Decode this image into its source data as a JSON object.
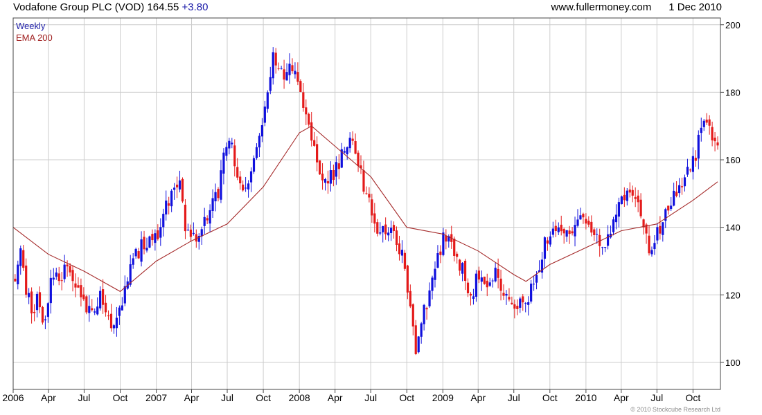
{
  "header": {
    "title": "Vodafone Group PLC (VOD)",
    "last": "164.55",
    "change": "+3.80",
    "site": "www.fullermoney.com",
    "date": "1 Dec 2010"
  },
  "footer": {
    "copyright": "© 2010 Stockcube Research Ltd"
  },
  "chart_data": {
    "type": "candlestick",
    "interval": "Weekly",
    "legend": [
      {
        "label": "Weekly",
        "color": "#2222aa"
      },
      {
        "label": "EMA 200",
        "color": "#a02020"
      }
    ],
    "colors": {
      "up": "#1010dd",
      "down": "#e41a1a",
      "ema": "#a52a2a",
      "grid": "#cccccc"
    },
    "y_axis": {
      "position": "right",
      "ylim": [
        92,
        202
      ],
      "ticks": [
        100,
        120,
        140,
        160,
        180,
        200
      ]
    },
    "x_axis": {
      "range": [
        "2006-01-01",
        "2010-12-10"
      ],
      "ticks": [
        {
          "label": "2006",
          "date": "2006-01-01"
        },
        {
          "label": "Apr",
          "date": "2006-04-01"
        },
        {
          "label": "Jul",
          "date": "2006-07-01"
        },
        {
          "label": "Oct",
          "date": "2006-10-01"
        },
        {
          "label": "2007",
          "date": "2007-01-01"
        },
        {
          "label": "Apr",
          "date": "2007-04-01"
        },
        {
          "label": "Jul",
          "date": "2007-07-01"
        },
        {
          "label": "Oct",
          "date": "2007-10-01"
        },
        {
          "label": "2008",
          "date": "2008-01-01"
        },
        {
          "label": "Apr",
          "date": "2008-04-01"
        },
        {
          "label": "Jul",
          "date": "2008-07-01"
        },
        {
          "label": "Oct",
          "date": "2008-10-01"
        },
        {
          "label": "2009",
          "date": "2009-01-01"
        },
        {
          "label": "Apr",
          "date": "2009-04-01"
        },
        {
          "label": "Jul",
          "date": "2009-07-01"
        },
        {
          "label": "Oct",
          "date": "2009-10-01"
        },
        {
          "label": "2010",
          "date": "2010-01-01"
        },
        {
          "label": "Apr",
          "date": "2010-04-01"
        },
        {
          "label": "Jul",
          "date": "2010-07-01"
        },
        {
          "label": "Oct",
          "date": "2010-10-01"
        }
      ]
    },
    "close_path": [
      [
        "2006-01-06",
        124
      ],
      [
        "2006-01-20",
        133
      ],
      [
        "2006-02-03",
        121
      ],
      [
        "2006-02-17",
        116
      ],
      [
        "2006-03-03",
        118
      ],
      [
        "2006-03-24",
        112
      ],
      [
        "2006-04-07",
        127
      ],
      [
        "2006-04-28",
        123
      ],
      [
        "2006-05-19",
        130
      ],
      [
        "2006-06-09",
        122
      ],
      [
        "2006-06-30",
        118
      ],
      [
        "2006-07-21",
        114
      ],
      [
        "2006-08-11",
        119
      ],
      [
        "2006-09-01",
        113
      ],
      [
        "2006-09-15",
        110
      ],
      [
        "2006-09-29",
        116
      ],
      [
        "2006-10-13",
        122
      ],
      [
        "2006-11-03",
        130
      ],
      [
        "2006-11-24",
        134
      ],
      [
        "2006-12-15",
        136
      ],
      [
        "2007-01-05",
        139
      ],
      [
        "2007-01-26",
        146
      ],
      [
        "2007-02-16",
        150
      ],
      [
        "2007-03-02",
        152
      ],
      [
        "2007-03-16",
        140
      ],
      [
        "2007-04-06",
        136
      ],
      [
        "2007-04-27",
        141
      ],
      [
        "2007-05-18",
        145
      ],
      [
        "2007-06-08",
        151
      ],
      [
        "2007-06-22",
        164
      ],
      [
        "2007-07-06",
        166
      ],
      [
        "2007-07-20",
        160
      ],
      [
        "2007-08-03",
        153
      ],
      [
        "2007-08-17",
        152
      ],
      [
        "2007-08-31",
        158
      ],
      [
        "2007-09-14",
        163
      ],
      [
        "2007-09-28",
        170
      ],
      [
        "2007-10-12",
        180
      ],
      [
        "2007-10-26",
        190
      ],
      [
        "2007-11-09",
        188
      ],
      [
        "2007-11-23",
        185
      ],
      [
        "2007-12-07",
        190
      ],
      [
        "2007-12-21",
        185
      ],
      [
        "2008-01-04",
        180
      ],
      [
        "2008-01-18",
        172
      ],
      [
        "2008-02-01",
        168
      ],
      [
        "2008-02-15",
        160
      ],
      [
        "2008-03-07",
        152
      ],
      [
        "2008-03-21",
        155
      ],
      [
        "2008-04-04",
        157
      ],
      [
        "2008-04-25",
        163
      ],
      [
        "2008-05-09",
        167
      ],
      [
        "2008-05-23",
        164
      ],
      [
        "2008-06-06",
        156
      ],
      [
        "2008-06-20",
        148
      ],
      [
        "2008-07-04",
        145
      ],
      [
        "2008-07-18",
        140
      ],
      [
        "2008-08-08",
        137
      ],
      [
        "2008-08-29",
        140
      ],
      [
        "2008-09-12",
        134
      ],
      [
        "2008-09-26",
        128
      ],
      [
        "2008-10-10",
        115
      ],
      [
        "2008-10-24",
        104
      ],
      [
        "2008-11-07",
        112
      ],
      [
        "2008-11-21",
        118
      ],
      [
        "2008-12-05",
        125
      ],
      [
        "2008-12-19",
        132
      ],
      [
        "2009-01-09",
        138
      ],
      [
        "2009-01-30",
        133
      ],
      [
        "2009-02-20",
        127
      ],
      [
        "2009-03-13",
        120
      ],
      [
        "2009-04-03",
        126
      ],
      [
        "2009-04-24",
        121
      ],
      [
        "2009-05-15",
        127
      ],
      [
        "2009-06-05",
        122
      ],
      [
        "2009-06-26",
        115
      ],
      [
        "2009-07-17",
        117
      ],
      [
        "2009-08-07",
        120
      ],
      [
        "2009-08-28",
        127
      ],
      [
        "2009-09-18",
        135
      ],
      [
        "2009-10-09",
        140
      ],
      [
        "2009-10-30",
        137
      ],
      [
        "2009-11-20",
        140
      ],
      [
        "2009-12-11",
        142
      ],
      [
        "2010-01-01",
        143
      ],
      [
        "2010-01-22",
        139
      ],
      [
        "2010-02-12",
        135
      ],
      [
        "2010-03-05",
        140
      ],
      [
        "2010-03-26",
        147
      ],
      [
        "2010-04-16",
        151
      ],
      [
        "2010-05-07",
        148
      ],
      [
        "2010-05-28",
        140
      ],
      [
        "2010-06-11",
        132
      ],
      [
        "2010-06-25",
        137
      ],
      [
        "2010-07-16",
        142
      ],
      [
        "2010-08-06",
        148
      ],
      [
        "2010-08-27",
        152
      ],
      [
        "2010-09-17",
        158
      ],
      [
        "2010-10-08",
        162
      ],
      [
        "2010-10-22",
        169
      ],
      [
        "2010-11-05",
        173
      ],
      [
        "2010-11-19",
        168
      ],
      [
        "2010-12-03",
        164.55
      ]
    ],
    "ema_200": [
      [
        "2006-01-01",
        140
      ],
      [
        "2006-04-01",
        132
      ],
      [
        "2006-07-01",
        127
      ],
      [
        "2006-10-01",
        121
      ],
      [
        "2007-01-01",
        130
      ],
      [
        "2007-04-01",
        136
      ],
      [
        "2007-07-01",
        141
      ],
      [
        "2007-10-01",
        152
      ],
      [
        "2008-01-01",
        168
      ],
      [
        "2008-02-01",
        170
      ],
      [
        "2008-04-01",
        164
      ],
      [
        "2008-07-01",
        155
      ],
      [
        "2008-10-01",
        140
      ],
      [
        "2009-01-01",
        138
      ],
      [
        "2009-04-01",
        133
      ],
      [
        "2009-07-01",
        126
      ],
      [
        "2009-08-01",
        124
      ],
      [
        "2009-10-01",
        129
      ],
      [
        "2010-01-01",
        134
      ],
      [
        "2010-04-01",
        139
      ],
      [
        "2010-07-01",
        141
      ],
      [
        "2010-10-01",
        148
      ],
      [
        "2010-12-03",
        153.5
      ]
    ]
  }
}
